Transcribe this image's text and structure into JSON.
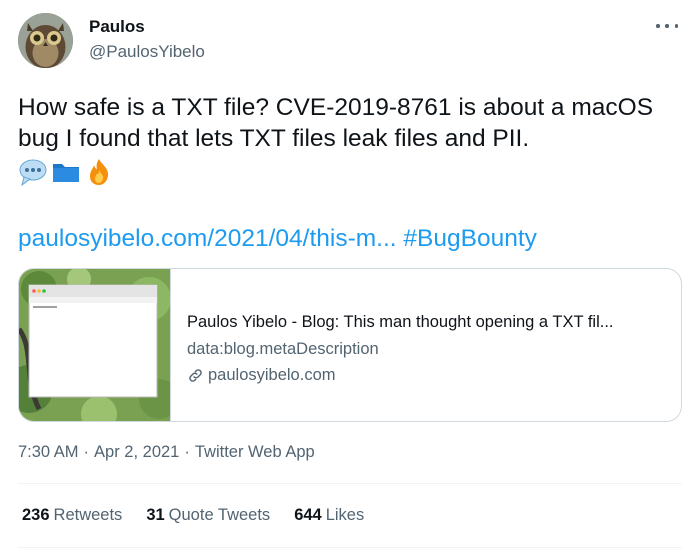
{
  "author": {
    "display_name": "Paulos",
    "handle": "@PaulosYibelo",
    "avatar_icon": "owl-avatar"
  },
  "tweet": {
    "text": "How safe is a TXT file? CVE-2019-8761 is about a macOS bug I found that lets TXT files leak files and PII.",
    "emojis": [
      "speech-balloon-icon",
      "folder-icon",
      "fire-icon"
    ],
    "link_text": "paulosyibelo.com/2021/04/this-m...",
    "hashtag": "#BugBounty"
  },
  "card": {
    "title": "Paulos Yibelo - Blog: This man thought opening a TXT fil...",
    "description": "data:blog.metaDescription",
    "domain": "paulosyibelo.com"
  },
  "meta": {
    "time": "7:30 AM",
    "separator": "·",
    "date": "Apr 2, 2021",
    "source": "Twitter Web App"
  },
  "stats": {
    "retweets_count": "236",
    "retweets_label": "Retweets",
    "quotes_count": "31",
    "quotes_label": "Quote Tweets",
    "likes_count": "644",
    "likes_label": "Likes"
  },
  "colors": {
    "link": "#1d9bf0",
    "secondary_text": "#536471",
    "primary_text": "#0f1419",
    "border": "#cfd9de"
  }
}
